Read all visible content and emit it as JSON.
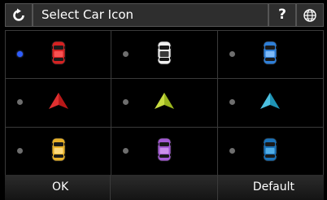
{
  "header": {
    "title": "Select Car Icon",
    "back_icon": "refresh-back-icon",
    "help_label": "?",
    "globe_icon": "globe-icon"
  },
  "selected_index": 0,
  "options": [
    {
      "kind": "car",
      "color": "#d42222",
      "accent": "#ff5a5a"
    },
    {
      "kind": "car",
      "color": "#f0f0f0",
      "accent": "#1a1a1a"
    },
    {
      "kind": "car",
      "color": "#2f7fd8",
      "accent": "#8cc4ff"
    },
    {
      "kind": "arrow",
      "color": "#b81818",
      "accent": "#e03030"
    },
    {
      "kind": "arrow",
      "color": "#9ab51e",
      "accent": "#c8dc40"
    },
    {
      "kind": "arrow",
      "color": "#1f93b5",
      "accent": "#4cc0e0"
    },
    {
      "kind": "car",
      "color": "#e7b12a",
      "accent": "#ffe08a"
    },
    {
      "kind": "car",
      "color": "#a25ad2",
      "accent": "#d29af0"
    },
    {
      "kind": "car",
      "color": "#1b72b8",
      "accent": "#5ab8f0"
    }
  ],
  "footer": {
    "ok_label": "OK",
    "default_label": "Default"
  }
}
